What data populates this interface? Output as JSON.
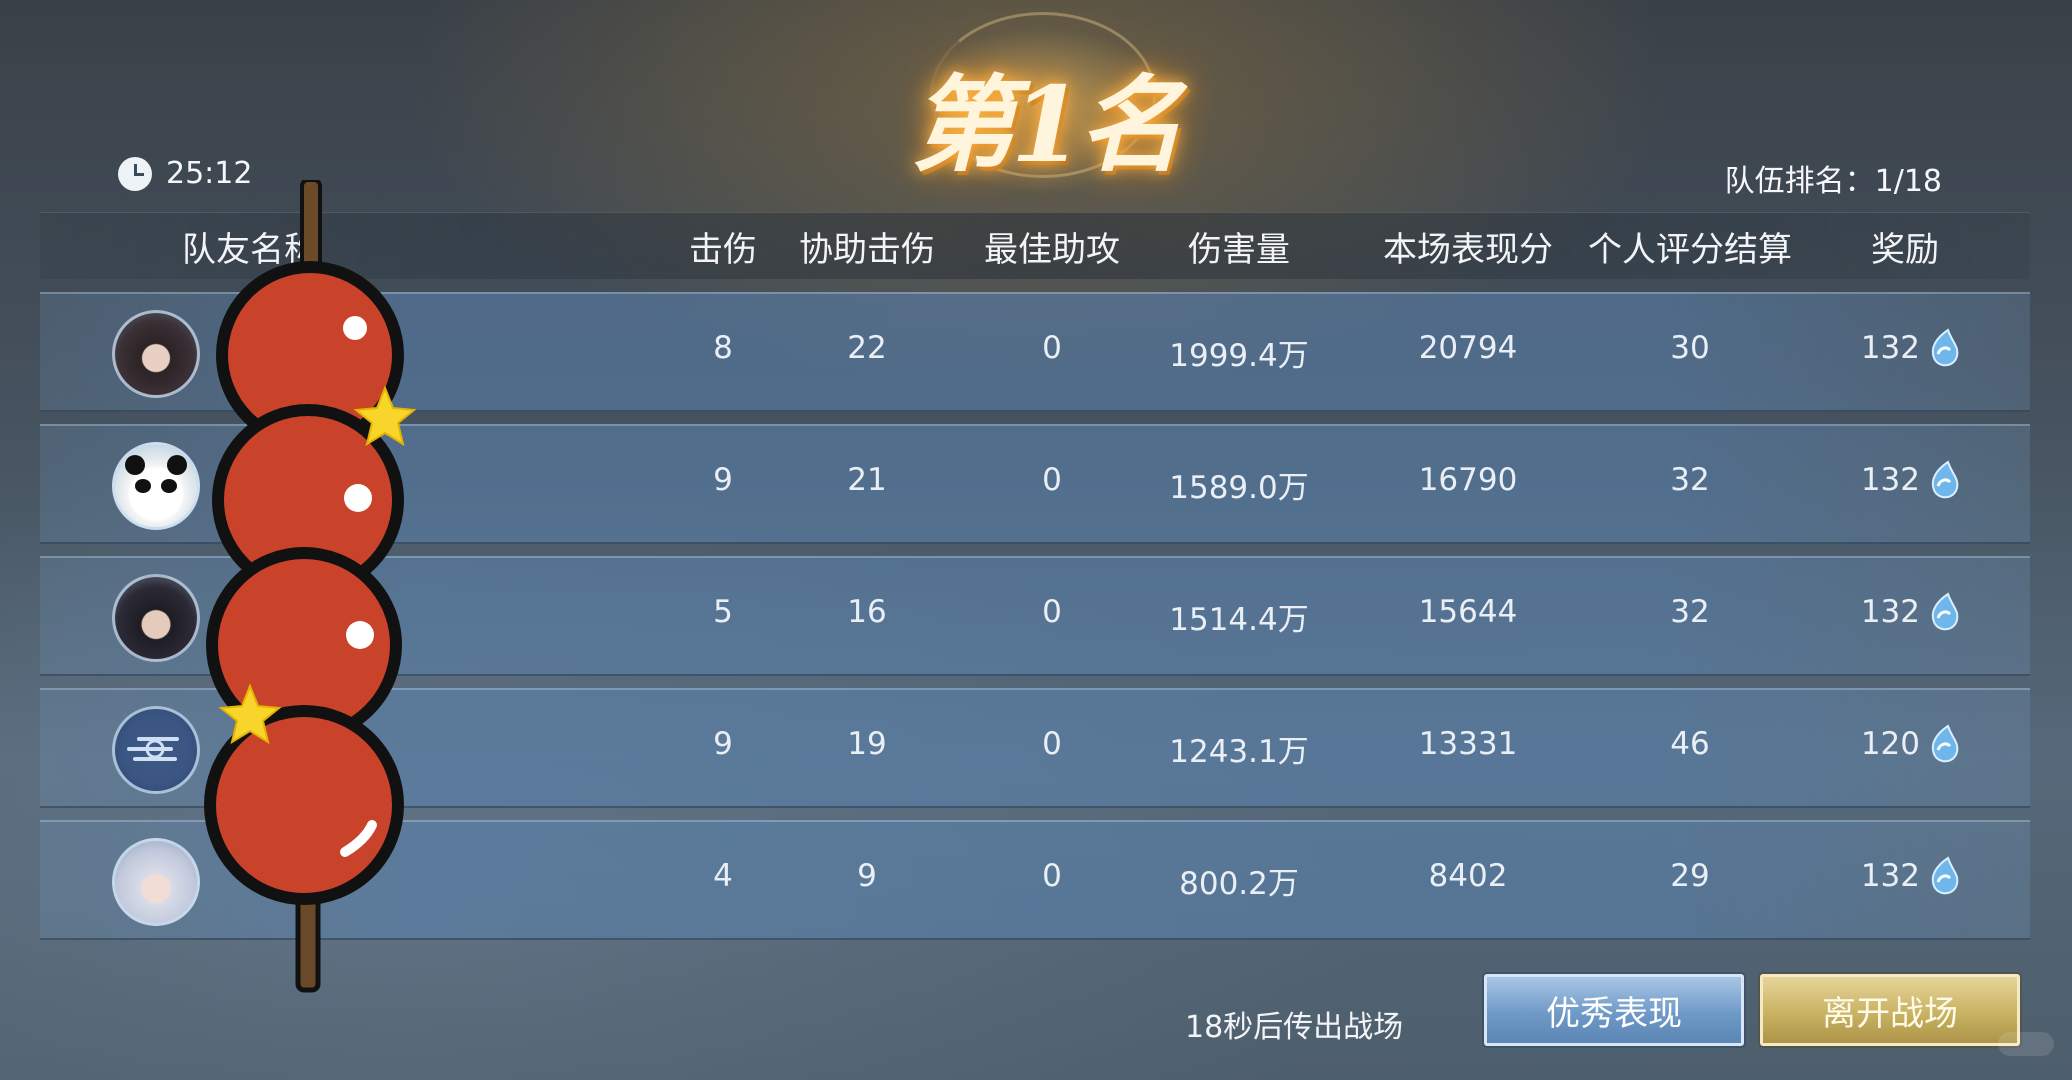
{
  "title": {
    "text": "第1名"
  },
  "timer": "25:12",
  "team_rank": {
    "label": "队伍排名：",
    "value": "1/18"
  },
  "columns": [
    "队友名称",
    "击伤",
    "协助击伤",
    "最佳助攻",
    "伤害量",
    "本场表现分",
    "个人评分结算",
    "奖励"
  ],
  "players": [
    {
      "avatar": "female-black-hair-avatar",
      "kills": "8",
      "assists": "22",
      "best_assist": "0",
      "damage": "1999.4万",
      "performance": "20794",
      "personal_score": "30",
      "reward": "132"
    },
    {
      "avatar": "panda-avatar",
      "kills": "9",
      "assists": "21",
      "best_assist": "0",
      "damage": "1589.0万",
      "performance": "16790",
      "personal_score": "32",
      "reward": "132"
    },
    {
      "avatar": "warrior-avatar",
      "kills": "5",
      "assists": "16",
      "best_assist": "0",
      "damage": "1514.4万",
      "performance": "15644",
      "personal_score": "32",
      "reward": "132"
    },
    {
      "avatar": "cloud-emblem-avatar",
      "kills": "9",
      "assists": "19",
      "best_assist": "0",
      "damage": "1243.1万",
      "performance": "13331",
      "personal_score": "46",
      "reward": "120"
    },
    {
      "avatar": "white-hair-avatar",
      "kills": "4",
      "assists": "9",
      "best_assist": "0",
      "damage": "800.2万",
      "performance": "8402",
      "personal_score": "29",
      "reward": "132"
    }
  ],
  "footer": {
    "countdown": "18秒后传出战场",
    "excellent_button": "优秀表现",
    "leave_button": "离开战场"
  },
  "colors": {
    "button_blue": "#7aa4cf",
    "button_gold": "#c9b263",
    "row_blue": "#5a82af",
    "title_glow": "#ffb84a"
  }
}
